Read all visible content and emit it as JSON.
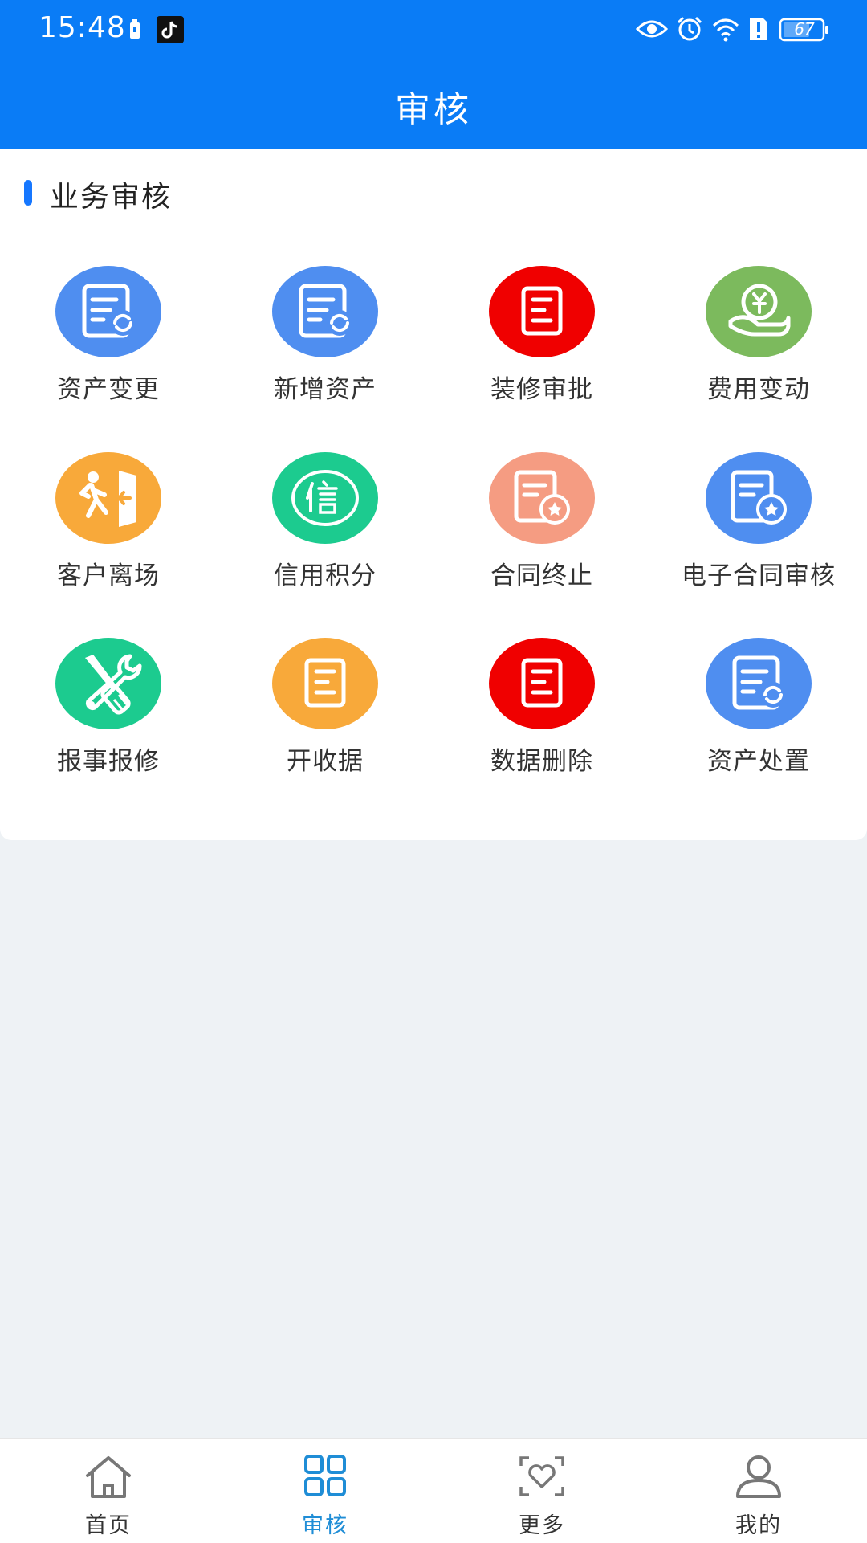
{
  "status_bar": {
    "time": "15:48",
    "battery": "67"
  },
  "header": {
    "title": "审核"
  },
  "section": {
    "title": "业务审核"
  },
  "grid_items": [
    {
      "label": "资产变更",
      "icon": "document-refresh-icon",
      "color": "#4f8ef0"
    },
    {
      "label": "新增资产",
      "icon": "document-refresh-icon",
      "color": "#4f8ef0"
    },
    {
      "label": "装修审批",
      "icon": "document-list-icon",
      "color": "#f00000"
    },
    {
      "label": "费用变动",
      "icon": "money-hand-icon",
      "color": "#7cba5d"
    },
    {
      "label": "客户离场",
      "icon": "exit-door-icon",
      "color": "#f8a93a"
    },
    {
      "label": "信用积分",
      "icon": "credit-badge-icon",
      "color": "#1ccb8f"
    },
    {
      "label": "合同终止",
      "icon": "contract-star-icon",
      "color": "#f59c82"
    },
    {
      "label": "电子合同审核",
      "icon": "contract-star-icon",
      "color": "#4f8ef0"
    },
    {
      "label": "报事报修",
      "icon": "wrench-screwdriver-icon",
      "color": "#1ccb8f"
    },
    {
      "label": "开收据",
      "icon": "document-list-icon",
      "color": "#f8a93a"
    },
    {
      "label": "数据删除",
      "icon": "document-list-icon",
      "color": "#f00000"
    },
    {
      "label": "资产处置",
      "icon": "document-refresh-icon",
      "color": "#4f8ef0"
    }
  ],
  "bottom_nav": [
    {
      "label": "首页",
      "icon": "home-icon",
      "active": false
    },
    {
      "label": "审核",
      "icon": "grid-icon",
      "active": true
    },
    {
      "label": "更多",
      "icon": "heart-scan-icon",
      "active": false
    },
    {
      "label": "我的",
      "icon": "user-icon",
      "active": false
    }
  ]
}
